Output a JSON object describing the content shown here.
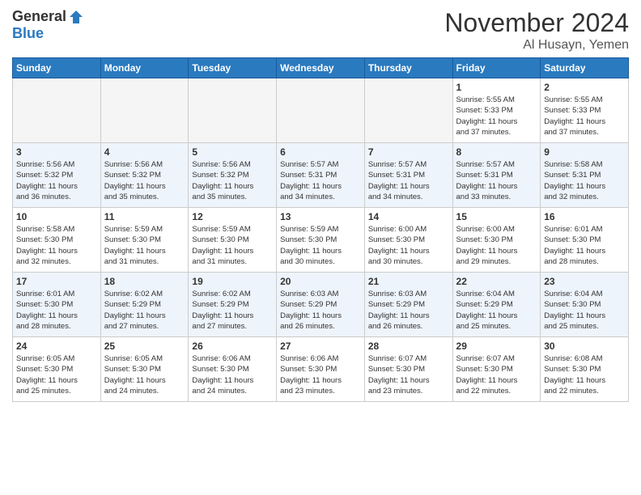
{
  "header": {
    "logo_general": "General",
    "logo_blue": "Blue",
    "month_title": "November 2024",
    "location": "Al Husayn, Yemen"
  },
  "days_of_week": [
    "Sunday",
    "Monday",
    "Tuesday",
    "Wednesday",
    "Thursday",
    "Friday",
    "Saturday"
  ],
  "weeks": [
    [
      {
        "day": "",
        "info": ""
      },
      {
        "day": "",
        "info": ""
      },
      {
        "day": "",
        "info": ""
      },
      {
        "day": "",
        "info": ""
      },
      {
        "day": "",
        "info": ""
      },
      {
        "day": "1",
        "info": "Sunrise: 5:55 AM\nSunset: 5:33 PM\nDaylight: 11 hours\nand 37 minutes."
      },
      {
        "day": "2",
        "info": "Sunrise: 5:55 AM\nSunset: 5:33 PM\nDaylight: 11 hours\nand 37 minutes."
      }
    ],
    [
      {
        "day": "3",
        "info": "Sunrise: 5:56 AM\nSunset: 5:32 PM\nDaylight: 11 hours\nand 36 minutes."
      },
      {
        "day": "4",
        "info": "Sunrise: 5:56 AM\nSunset: 5:32 PM\nDaylight: 11 hours\nand 35 minutes."
      },
      {
        "day": "5",
        "info": "Sunrise: 5:56 AM\nSunset: 5:32 PM\nDaylight: 11 hours\nand 35 minutes."
      },
      {
        "day": "6",
        "info": "Sunrise: 5:57 AM\nSunset: 5:31 PM\nDaylight: 11 hours\nand 34 minutes."
      },
      {
        "day": "7",
        "info": "Sunrise: 5:57 AM\nSunset: 5:31 PM\nDaylight: 11 hours\nand 34 minutes."
      },
      {
        "day": "8",
        "info": "Sunrise: 5:57 AM\nSunset: 5:31 PM\nDaylight: 11 hours\nand 33 minutes."
      },
      {
        "day": "9",
        "info": "Sunrise: 5:58 AM\nSunset: 5:31 PM\nDaylight: 11 hours\nand 32 minutes."
      }
    ],
    [
      {
        "day": "10",
        "info": "Sunrise: 5:58 AM\nSunset: 5:30 PM\nDaylight: 11 hours\nand 32 minutes."
      },
      {
        "day": "11",
        "info": "Sunrise: 5:59 AM\nSunset: 5:30 PM\nDaylight: 11 hours\nand 31 minutes."
      },
      {
        "day": "12",
        "info": "Sunrise: 5:59 AM\nSunset: 5:30 PM\nDaylight: 11 hours\nand 31 minutes."
      },
      {
        "day": "13",
        "info": "Sunrise: 5:59 AM\nSunset: 5:30 PM\nDaylight: 11 hours\nand 30 minutes."
      },
      {
        "day": "14",
        "info": "Sunrise: 6:00 AM\nSunset: 5:30 PM\nDaylight: 11 hours\nand 30 minutes."
      },
      {
        "day": "15",
        "info": "Sunrise: 6:00 AM\nSunset: 5:30 PM\nDaylight: 11 hours\nand 29 minutes."
      },
      {
        "day": "16",
        "info": "Sunrise: 6:01 AM\nSunset: 5:30 PM\nDaylight: 11 hours\nand 28 minutes."
      }
    ],
    [
      {
        "day": "17",
        "info": "Sunrise: 6:01 AM\nSunset: 5:30 PM\nDaylight: 11 hours\nand 28 minutes."
      },
      {
        "day": "18",
        "info": "Sunrise: 6:02 AM\nSunset: 5:29 PM\nDaylight: 11 hours\nand 27 minutes."
      },
      {
        "day": "19",
        "info": "Sunrise: 6:02 AM\nSunset: 5:29 PM\nDaylight: 11 hours\nand 27 minutes."
      },
      {
        "day": "20",
        "info": "Sunrise: 6:03 AM\nSunset: 5:29 PM\nDaylight: 11 hours\nand 26 minutes."
      },
      {
        "day": "21",
        "info": "Sunrise: 6:03 AM\nSunset: 5:29 PM\nDaylight: 11 hours\nand 26 minutes."
      },
      {
        "day": "22",
        "info": "Sunrise: 6:04 AM\nSunset: 5:29 PM\nDaylight: 11 hours\nand 25 minutes."
      },
      {
        "day": "23",
        "info": "Sunrise: 6:04 AM\nSunset: 5:30 PM\nDaylight: 11 hours\nand 25 minutes."
      }
    ],
    [
      {
        "day": "24",
        "info": "Sunrise: 6:05 AM\nSunset: 5:30 PM\nDaylight: 11 hours\nand 25 minutes."
      },
      {
        "day": "25",
        "info": "Sunrise: 6:05 AM\nSunset: 5:30 PM\nDaylight: 11 hours\nand 24 minutes."
      },
      {
        "day": "26",
        "info": "Sunrise: 6:06 AM\nSunset: 5:30 PM\nDaylight: 11 hours\nand 24 minutes."
      },
      {
        "day": "27",
        "info": "Sunrise: 6:06 AM\nSunset: 5:30 PM\nDaylight: 11 hours\nand 23 minutes."
      },
      {
        "day": "28",
        "info": "Sunrise: 6:07 AM\nSunset: 5:30 PM\nDaylight: 11 hours\nand 23 minutes."
      },
      {
        "day": "29",
        "info": "Sunrise: 6:07 AM\nSunset: 5:30 PM\nDaylight: 11 hours\nand 22 minutes."
      },
      {
        "day": "30",
        "info": "Sunrise: 6:08 AM\nSunset: 5:30 PM\nDaylight: 11 hours\nand 22 minutes."
      }
    ]
  ]
}
